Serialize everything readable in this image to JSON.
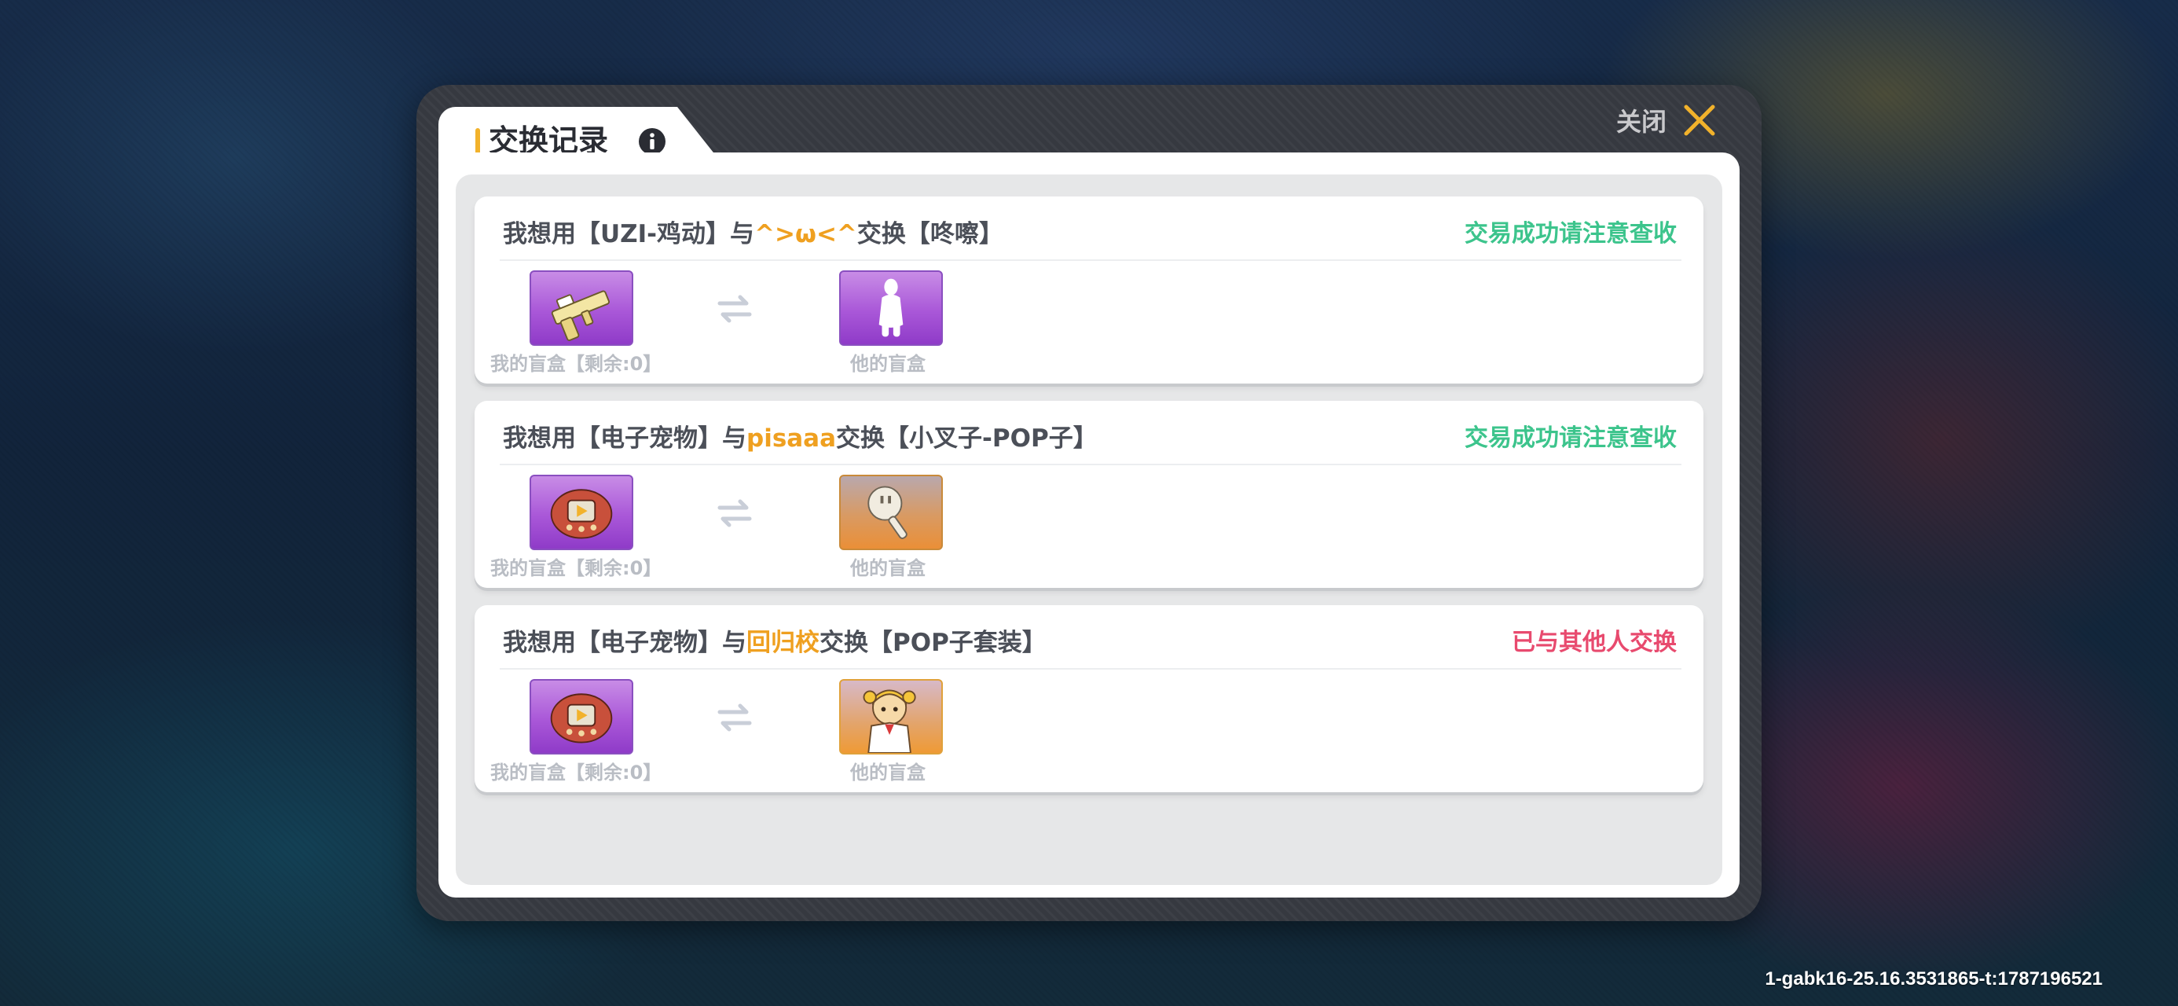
{
  "dialog": {
    "title": "交换记录",
    "close_label": "关闭"
  },
  "records": [
    {
      "prefix": "我想用【UZI-鸡动】与",
      "partner": "^>ω<^",
      "suffix": "交换【咚嚓】",
      "status": "交易成功请注意查收",
      "status_color": "#3cc48c",
      "my_box_caption": "我的盲盒【剩余:0】",
      "his_box_caption": "他的盲盒"
    },
    {
      "prefix": "我想用【电子宠物】与",
      "partner": "pisaaa",
      "suffix": "交换【小叉子-POP子】",
      "status": "交易成功请注意查收",
      "status_color": "#3cc48c",
      "my_box_caption": "我的盲盒【剩余:0】",
      "his_box_caption": "他的盲盒"
    },
    {
      "prefix": "我想用【电子宠物】与",
      "partner": "回归校",
      "suffix": "交换【POP子套装】",
      "status": "已与其他人交换",
      "status_color": "#e84a6e",
      "my_box_caption": "我的盲盒【剩余:0】",
      "his_box_caption": "他的盲盒"
    }
  ],
  "icons": {
    "info": "info-icon",
    "close": "close-x-icon",
    "swap": "swap-arrows-icon"
  },
  "colors": {
    "accent": "#f2b22b",
    "partner_name": "#efa020",
    "rare_purple": "#a957d8",
    "rare_orange": "#ea8f37"
  },
  "version_text": "1-gabk16-25.16.3531865-t:1787196521"
}
